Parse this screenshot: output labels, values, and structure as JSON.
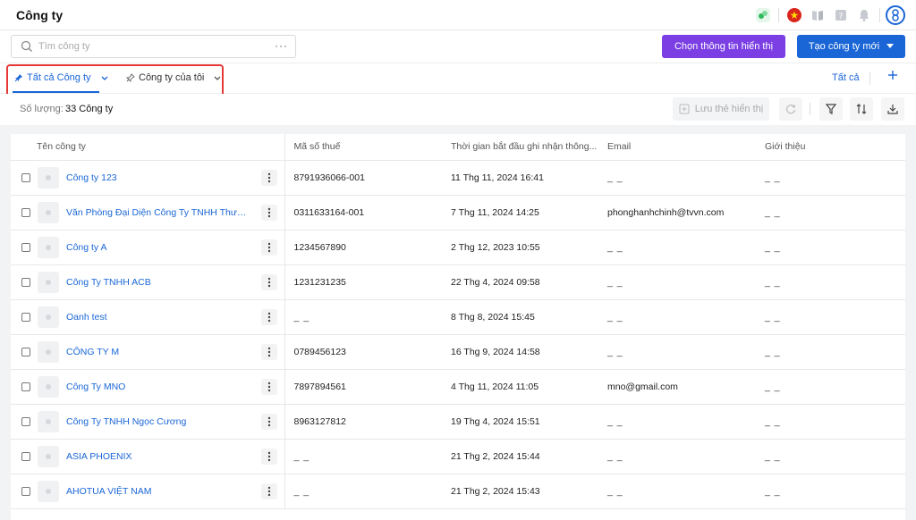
{
  "header": {
    "title": "Công ty"
  },
  "search": {
    "placeholder": "Tìm công ty",
    "more": "···"
  },
  "actions": {
    "choose_info": "Chọn thông tin hiển thị",
    "create_company": "Tạo công ty mới"
  },
  "tabs": [
    {
      "label": "Tất cả Công ty",
      "active": true
    },
    {
      "label": "Công ty của tôi",
      "active": false
    }
  ],
  "view_all": "Tất cả",
  "summary": {
    "label": "Số lượng:",
    "value": "33 Công ty"
  },
  "toolbar": {
    "save_view": "Lưu thẻ hiển thị"
  },
  "table": {
    "columns": [
      "Tên công ty",
      "Mã số thuế",
      "Thời gian bắt đầu ghi nhận thông...",
      "Email",
      "Giới thiệu"
    ],
    "rows": [
      {
        "name": "Công ty 123",
        "tax": "8791936066-001",
        "time": "11 Thg 11, 2024 16:41",
        "email": "_ _",
        "intro": "_ _"
      },
      {
        "name": "Văn Phòng Đại Diện Công Ty TNHH Thươn...",
        "tax": "0311633164-001",
        "time": "7 Thg 11, 2024 14:25",
        "email": "phonghanhchinh@tvvn.com",
        "intro": "_ _"
      },
      {
        "name": "Công ty A",
        "tax": "1234567890",
        "time": "2 Thg 12, 2023 10:55",
        "email": "_ _",
        "intro": "_ _"
      },
      {
        "name": "Công Ty TNHH ACB",
        "tax": "1231231235",
        "time": "22 Thg 4, 2024 09:58",
        "email": "_ _",
        "intro": "_ _"
      },
      {
        "name": "Oanh test",
        "tax": "_ _",
        "time": "8 Thg 8, 2024 15:45",
        "email": "_ _",
        "intro": "_ _"
      },
      {
        "name": "CÔNG TY M",
        "tax": "0789456123",
        "time": "16 Thg 9, 2024 14:58",
        "email": "_ _",
        "intro": "_ _"
      },
      {
        "name": "Công Ty MNO",
        "tax": "7897894561",
        "time": "4 Thg 11, 2024 11:05",
        "email": "mno@gmail.com",
        "intro": "_ _"
      },
      {
        "name": "Công Ty TNHH Ngọc Cương",
        "tax": "8963127812",
        "time": "19 Thg 4, 2024 15:51",
        "email": "_ _",
        "intro": "_ _"
      },
      {
        "name": "ASIA PHOENIX",
        "tax": "_ _",
        "time": "21 Thg 2, 2024 15:44",
        "email": "_ _",
        "intro": "_ _"
      },
      {
        "name": "AHOTUA VIỆT NAM",
        "tax": "_ _",
        "time": "21 Thg 2, 2024 15:43",
        "email": "_ _",
        "intro": "_ _"
      }
    ]
  },
  "colors": {
    "accent": "#1a66d6",
    "purple": "#7b3fe4",
    "highlight": "#e53935"
  }
}
